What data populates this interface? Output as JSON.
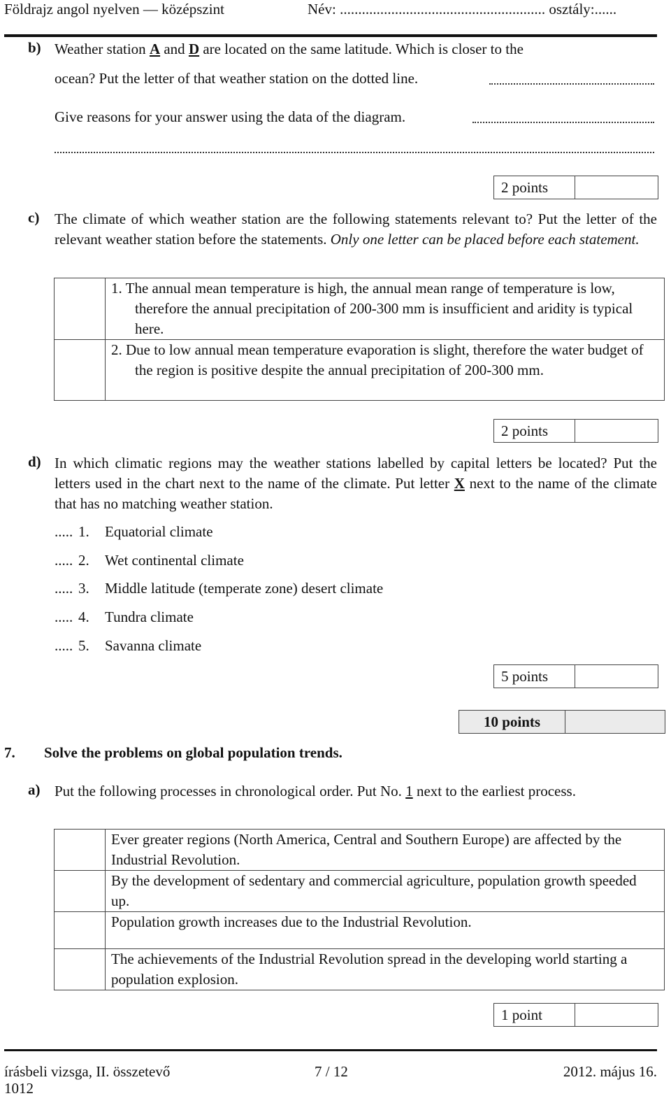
{
  "header": {
    "subject": "Földrajz angol nyelven — középszint",
    "name_label": "Név: ........................................................",
    "class_label": "osztály:......"
  },
  "task6": {
    "b": {
      "label": "b)",
      "line1_pre": "Weather station ",
      "letter_a": "A",
      "line1_mid": " and ",
      "letter_d": "D",
      "line1_post": " are located on the same latitude. Which is closer to the",
      "line2": "ocean? Put the letter of that weather station on the dotted line.",
      "line3": "Give reasons for your answer using the data of the diagram.",
      "points": "2 points"
    },
    "c": {
      "label": "c)",
      "text": "The climate of which weather station are the following statements relevant to? Put the letter of the relevant weather station before the statements.",
      "text_italic": "Only one letter can be placed before each statement.",
      "statements": [
        "1. The annual mean temperature is high, the annual mean range of temperature is low, therefore the annual precipitation of 200-300 mm is insufficient and aridity is typical here.",
        "2. Due to low annual mean temperature evaporation is slight, therefore the water budget of the region is positive despite the annual precipitation of 200-300 mm."
      ],
      "points": "2 points"
    },
    "d": {
      "label": "d)",
      "text_pre": "In which climatic regions may the weather stations labelled by capital letters be located? Put the letters used in the chart next to the name of the climate. Put letter ",
      "letter_x": "X",
      "text_post": " next to the name of the climate that has no matching weather station.",
      "climates": [
        {
          "dots": ".....",
          "num": "1.",
          "name": "Equatorial climate"
        },
        {
          "dots": ".....",
          "num": "2.",
          "name": "Wet continental climate"
        },
        {
          "dots": ".....",
          "num": "3.",
          "name": "Middle latitude (temperate zone) desert climate"
        },
        {
          "dots": ".....",
          "num": "4.",
          "name": "Tundra climate"
        },
        {
          "dots": ".....",
          "num": "5.",
          "name": "Savanna climate"
        }
      ],
      "points": "5 points"
    },
    "total_points": "10 points"
  },
  "task7": {
    "number": "7.",
    "title": "Solve the problems on global population trends.",
    "a": {
      "label": "a)",
      "text_pre": "Put the following processes in chronological order. Put No. ",
      "number_one": "1",
      "text_post": " next to the earliest process.",
      "processes": [
        "Ever greater regions (North America, Central and Southern Europe) are affected by the Industrial Revolution.",
        "By the development of sedentary and commercial agriculture, population growth speeded up.",
        "Population growth increases due to the Industrial Revolution.",
        "The achievements of the Industrial Revolution spread in the developing world starting a population explosion."
      ],
      "points": "1 point"
    }
  },
  "footer": {
    "left_line1": "írásbeli vizsga, II. összetevő",
    "left_line2": "1012",
    "page": "7 / 12",
    "date": "2012. május 16."
  }
}
